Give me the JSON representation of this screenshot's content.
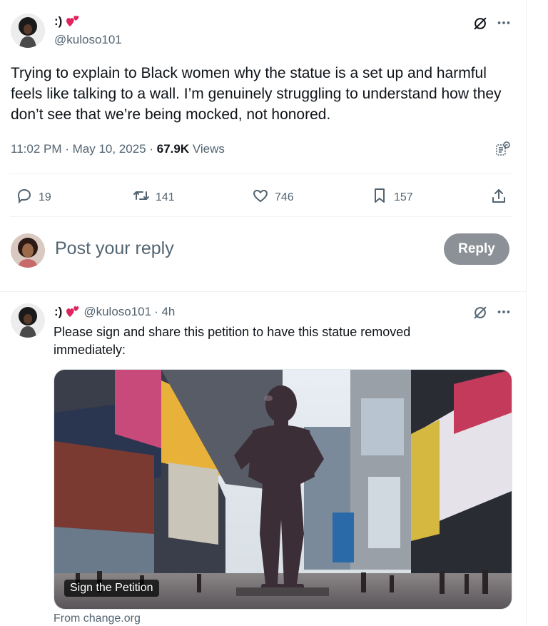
{
  "tweet": {
    "display_name": ":)",
    "handle": "@kuloso101",
    "text": "Trying to explain to Black women why the statue is a set up and harmful feels like talking to a wall. I’m genuinely struggling to understand how they don’t see that we’re being mocked, not honored.",
    "time": "11:02 PM · May 10, 2025 · ",
    "views_count": "67.9K",
    "views_label": " Views",
    "stats": {
      "replies": "19",
      "retweets": "141",
      "likes": "746",
      "bookmarks": "157"
    }
  },
  "composer": {
    "placeholder": "Post your reply",
    "button": "Reply"
  },
  "reply": {
    "display_name": ":)",
    "handle": "@kuloso101",
    "time": " · 4h",
    "text": "Please sign and share this petition to have this statue removed immediately:",
    "media_caption": "Sign the Petition",
    "source": "From change.org"
  },
  "colors": {
    "text": "#0f1419",
    "muted": "#536471",
    "divider": "#eff3f4",
    "heart": "#e0245e",
    "reply_button": "#8b9196"
  },
  "icons": [
    "heart-icon",
    "grok-icon",
    "more-icon",
    "reply-icon",
    "retweet-icon",
    "like-icon",
    "bookmark-icon",
    "share-icon",
    "analytics-icon"
  ]
}
